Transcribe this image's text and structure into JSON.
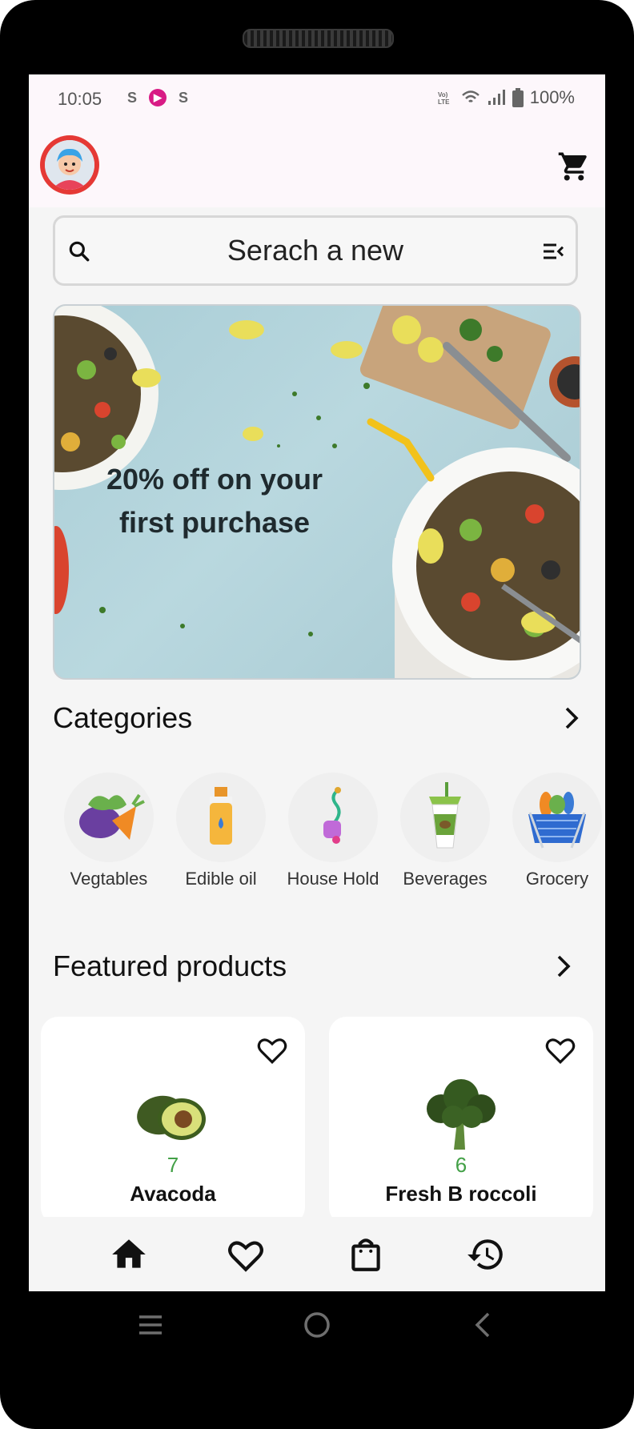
{
  "status_bar": {
    "time": "10:05",
    "left_icons": [
      "s-icon",
      "pink-app-icon",
      "s-icon"
    ],
    "battery": "100%"
  },
  "app_bar": {
    "avatar": "avatar-icon",
    "cart": "cart-icon"
  },
  "search": {
    "placeholder": "Serach a new"
  },
  "banner": {
    "line1": "20% off on your",
    "line2": "first purchase"
  },
  "categories": {
    "title": "Categories",
    "items": [
      {
        "label": "Vegtables",
        "icon": "vegetables-icon"
      },
      {
        "label": "Edible oil",
        "icon": "oil-bottle-icon"
      },
      {
        "label": "House Hold",
        "icon": "vacuum-icon"
      },
      {
        "label": "Beverages",
        "icon": "drink-cup-icon"
      },
      {
        "label": "Grocery",
        "icon": "basket-icon"
      }
    ]
  },
  "featured": {
    "title": "Featured products",
    "products": [
      {
        "count": "7",
        "name": "Avacoda"
      },
      {
        "count": "6",
        "name": "Fresh B roccoli"
      }
    ]
  },
  "bottom_nav": [
    "home-icon",
    "heart-icon",
    "bag-icon",
    "history-icon"
  ],
  "system_nav": [
    "menu-icon",
    "home-circle-icon",
    "back-icon"
  ],
  "colors": {
    "accent_red": "#e53935",
    "price_green": "#43a047",
    "background": "#f5f5f5"
  }
}
